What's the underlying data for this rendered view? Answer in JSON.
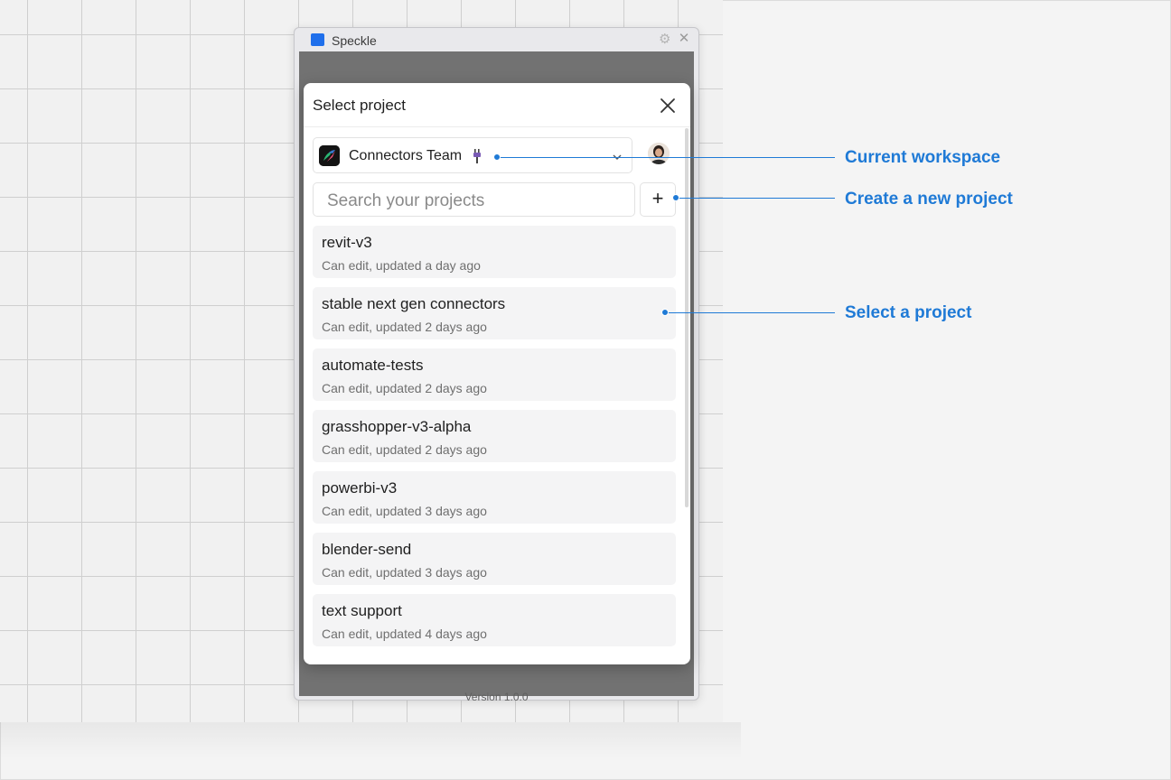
{
  "window": {
    "title": "Speckle",
    "version": "Version 1.0.0"
  },
  "modal": {
    "title": "Select project"
  },
  "workspace": {
    "name": "Connectors Team"
  },
  "search": {
    "placeholder": "Search your projects"
  },
  "add_button": {
    "label": "+"
  },
  "projects": [
    {
      "name": "revit-v3",
      "meta": "Can edit, updated a day ago"
    },
    {
      "name": "stable next gen connectors",
      "meta": "Can edit, updated 2 days ago"
    },
    {
      "name": "automate-tests",
      "meta": "Can edit, updated 2 days ago"
    },
    {
      "name": "grasshopper-v3-alpha",
      "meta": "Can edit, updated 2 days ago"
    },
    {
      "name": "powerbi-v3",
      "meta": "Can edit, updated 3 days ago"
    },
    {
      "name": "blender-send",
      "meta": "Can edit, updated 3 days ago"
    },
    {
      "name": "text support",
      "meta": "Can edit, updated 4 days ago"
    }
  ],
  "annotations": {
    "current_workspace": "Current workspace",
    "create_project": "Create a new project",
    "select_project": "Select a project"
  },
  "colors": {
    "accent": "#1f7ad6",
    "brand": "#1f6feb"
  }
}
